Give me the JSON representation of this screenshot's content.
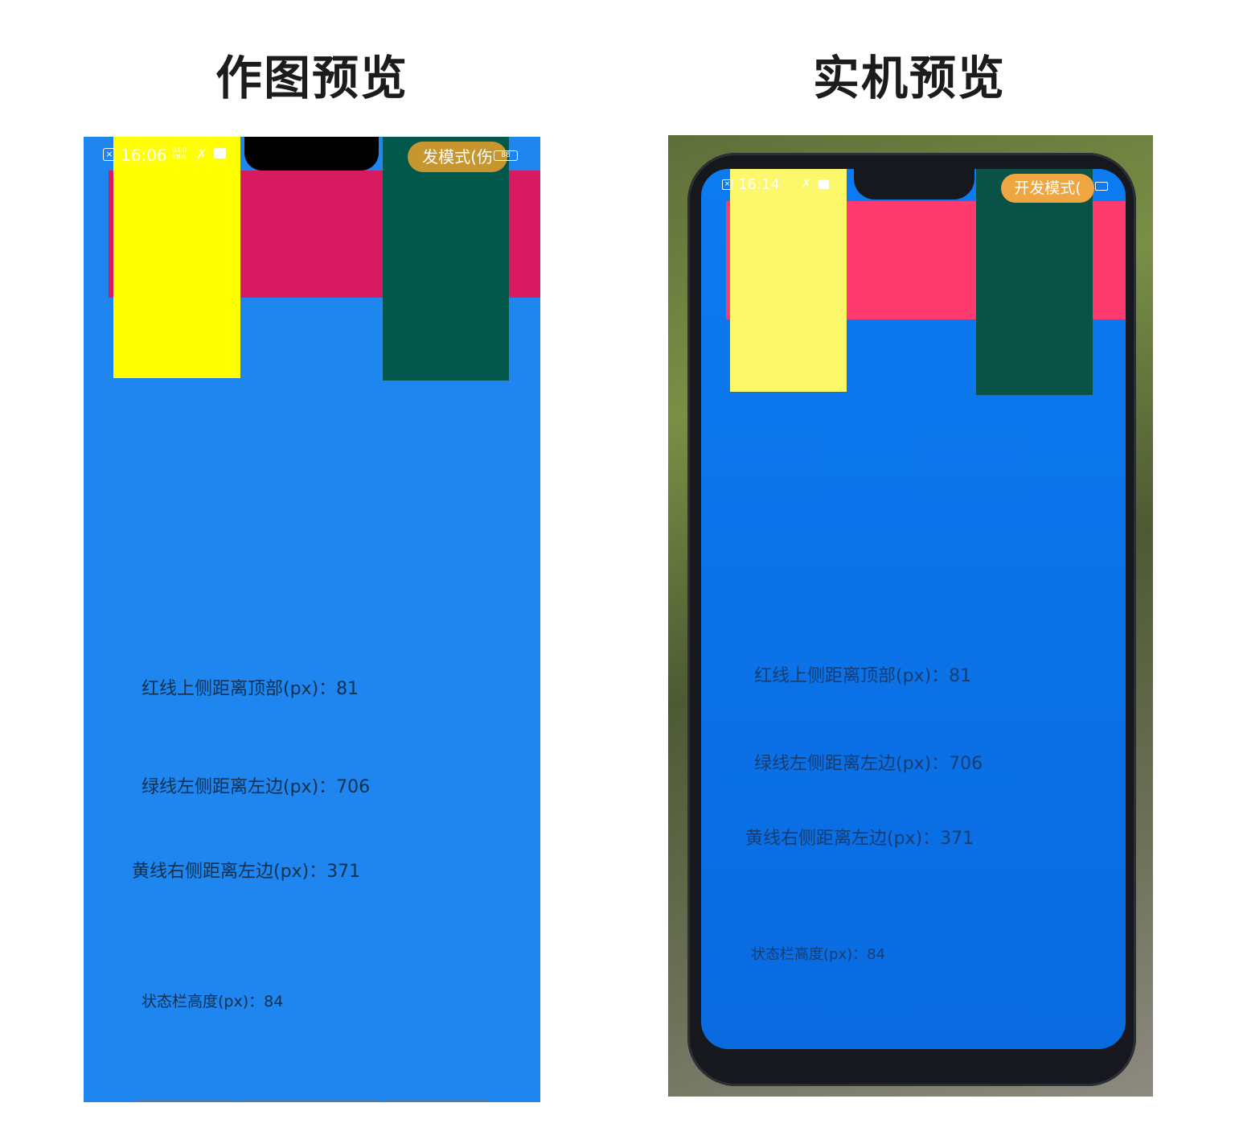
{
  "headings": {
    "left": "作图预览",
    "right": "实机预览"
  },
  "colors": {
    "background_blue": "#1e86ee",
    "red_band": "#d81b60",
    "yellow_block": "#ffff00",
    "green_block": "#02584a",
    "dev_pill": "#c8962e",
    "photo_screen_blue": "#0c7af0",
    "photo_red_band": "#ff3a6f",
    "photo_yellow_block": "#fdf86a",
    "photo_dev_pill": "#f0a640"
  },
  "design_preview": {
    "status_bar": {
      "time": "16:06",
      "speed_value": "0.00",
      "speed_unit": "KB/s",
      "icons": [
        "close-box-icon",
        "tools-icon",
        "mail-icon"
      ],
      "dev_mode_label": "发模式(伤",
      "battery": "88"
    },
    "info": {
      "red_top": "红线上侧距离顶部(px)：81",
      "green_left": "绿线左侧距离左边(px)：706",
      "yellow_right": "黄线右侧距离左边(px)：371",
      "statusbar_height": "状态栏高度(px)：84"
    }
  },
  "device_preview": {
    "status_bar": {
      "time": "16:14",
      "icons": [
        "close-box-icon",
        "tools-icon",
        "mail-icon"
      ],
      "dev_mode_label": "开发模式("
    },
    "info": {
      "red_top": "红线上侧距离顶部(px)：81",
      "green_left": "绿线左侧距离左边(px)：706",
      "yellow_right": "黄线右侧距离左边(px)：371",
      "statusbar_height": "状态栏高度(px)：84"
    }
  }
}
